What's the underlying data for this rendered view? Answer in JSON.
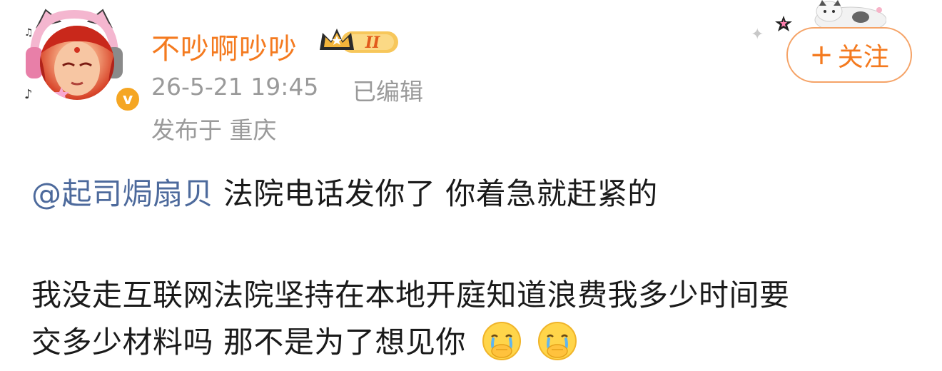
{
  "user": {
    "name": "不吵啊吵吵",
    "level_badge": "II",
    "verified_mark": "v"
  },
  "meta": {
    "time": "26-5-21 19:45",
    "edited": "已编辑",
    "location": "发布于 重庆"
  },
  "follow_button": {
    "plus": "+",
    "label": "关注"
  },
  "post": {
    "mention": "@起司焗扇贝",
    "line1_text": " 法院电话发你了 你着急就赶紧的",
    "line2_text": "我没走互联网法院坚持在本地开庭知道浪费我多少时间要",
    "line3_text": "交多少材料吗 那不是为了想见你",
    "emojis": [
      "crying-covering-mouth-icon",
      "crying-covering-mouth-icon"
    ]
  },
  "colors": {
    "name": "#f47a1f",
    "mention": "#4d6a9c",
    "meta": "#9a9a9a",
    "follow_border": "#f5a367",
    "verified": "#f5a623"
  }
}
